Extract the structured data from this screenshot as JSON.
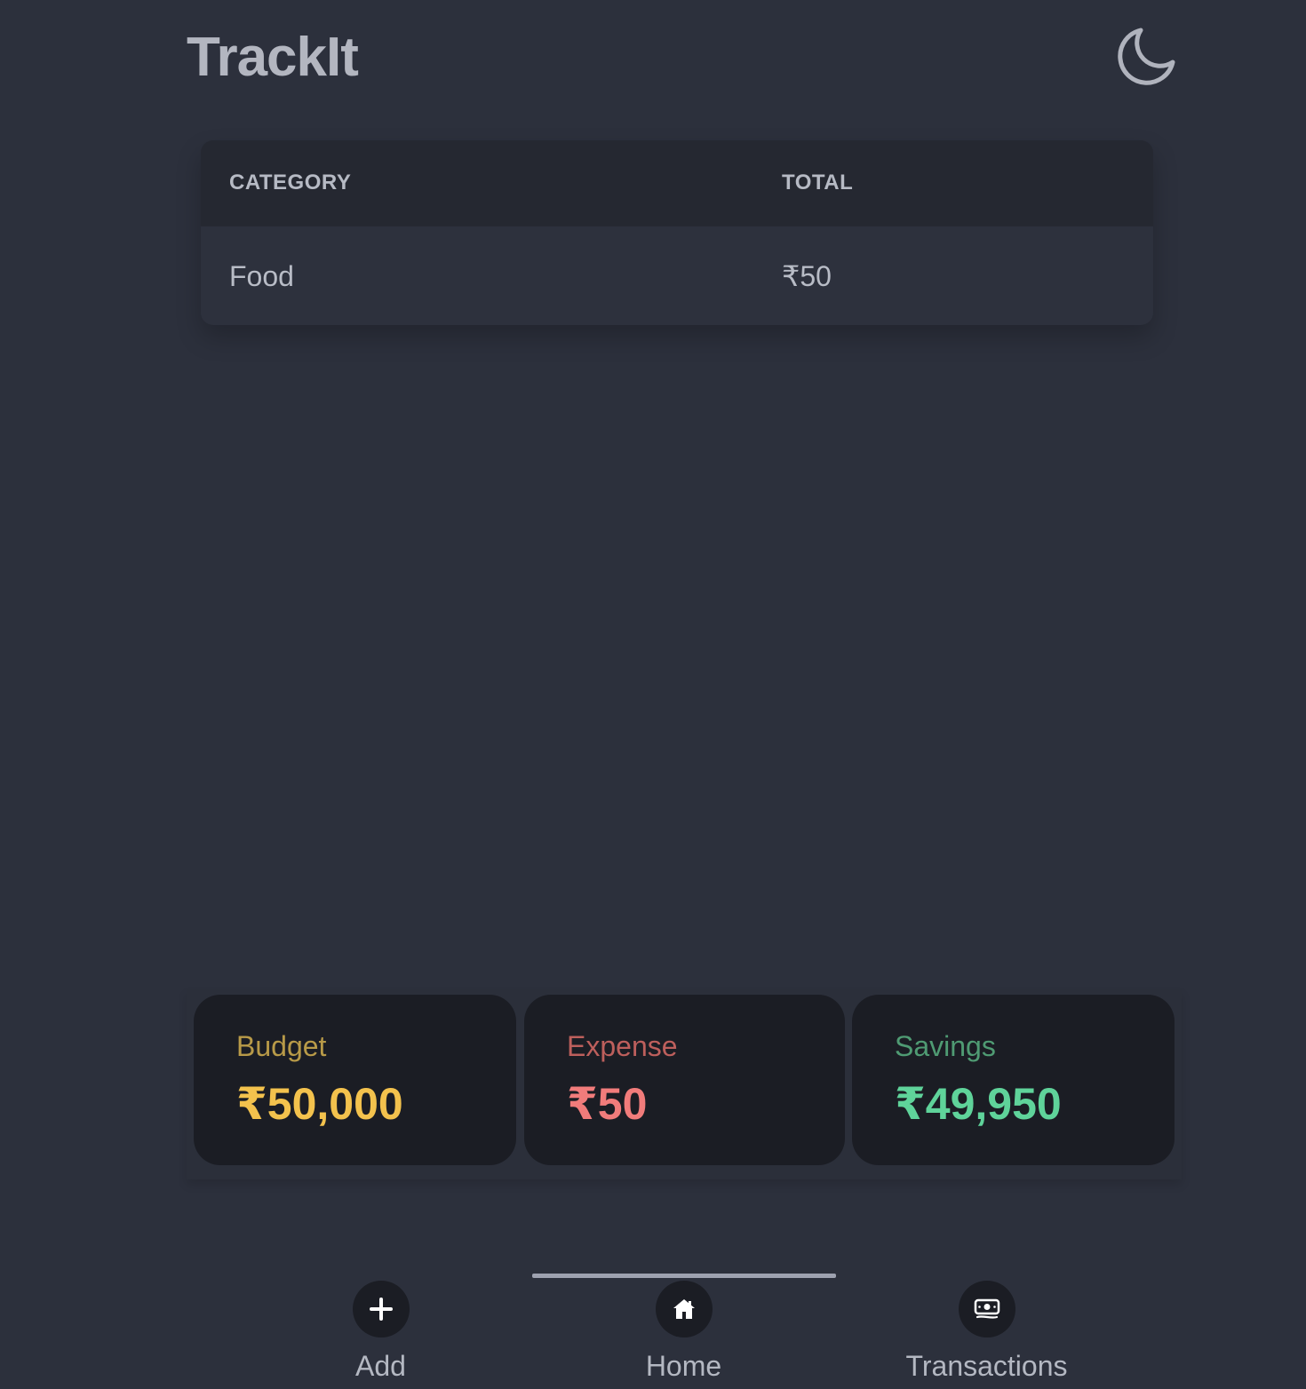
{
  "app": {
    "title": "TrackIt"
  },
  "header": {
    "theme_toggle_icon": "moon-icon"
  },
  "table": {
    "headers": [
      "CATEGORY",
      "TOTAL"
    ],
    "rows": [
      {
        "category": "Food",
        "total": "₹50"
      }
    ]
  },
  "summary": {
    "budget": {
      "label": "Budget",
      "value": "₹50,000",
      "color": "#f3c24d"
    },
    "expense": {
      "label": "Expense",
      "value": "₹50",
      "color": "#f17c7b"
    },
    "savings": {
      "label": "Savings",
      "value": "₹49,950",
      "color": "#5fd39a"
    }
  },
  "nav": {
    "items": [
      {
        "label": "Add",
        "icon": "plus-icon"
      },
      {
        "label": "Home",
        "icon": "home-icon",
        "active": true
      },
      {
        "label": "Transactions",
        "icon": "money-icon"
      }
    ]
  }
}
